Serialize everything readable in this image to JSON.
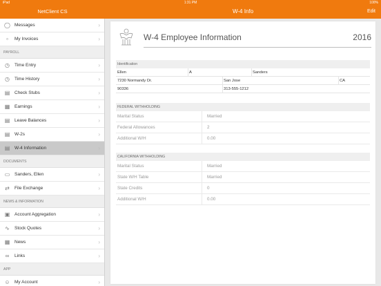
{
  "status_bar": {
    "carrier": "iPad",
    "time": "1:31 PM",
    "battery": "100%"
  },
  "left_nav": {
    "title": "NetClient CS"
  },
  "right_nav": {
    "title": "W-4 Info",
    "edit_label": "Edit"
  },
  "sidebar": {
    "top_items": [
      {
        "label": "Messages",
        "icon": "chat-bubble-icon"
      },
      {
        "label": "My Invoices",
        "icon": "invoice-icon"
      }
    ],
    "payroll_header": "PAYROLL",
    "payroll_items": [
      {
        "label": "Time Entry",
        "icon": "clock-icon"
      },
      {
        "label": "Time History",
        "icon": "clock-history-icon"
      },
      {
        "label": "Check Stubs",
        "icon": "document-icon"
      },
      {
        "label": "Earnings",
        "icon": "earnings-icon"
      },
      {
        "label": "Leave Balances",
        "icon": "document-icon"
      },
      {
        "label": "W-2s",
        "icon": "document-icon"
      },
      {
        "label": "W-4 Information",
        "icon": "w4-form-icon"
      }
    ],
    "documents_header": "DOCUMENTS",
    "documents_items": [
      {
        "label": "Sanders, Ellen",
        "icon": "folder-icon"
      },
      {
        "label": "File Exchange",
        "icon": "file-exchange-icon"
      }
    ],
    "news_header": "NEWS & INFORMATION",
    "news_items": [
      {
        "label": "Account Aggregation",
        "icon": "account-icon"
      },
      {
        "label": "Stock Quotes",
        "icon": "stock-chart-icon"
      },
      {
        "label": "News",
        "icon": "news-icon"
      },
      {
        "label": "Links",
        "icon": "link-icon"
      }
    ],
    "app_header": "APP",
    "app_items": [
      {
        "label": "My Account",
        "icon": "person-icon"
      }
    ]
  },
  "form": {
    "title": "W-4 Employee Information",
    "year": "2016",
    "identification": {
      "header": "Identification",
      "first_name": "Ellen",
      "middle_initial": "A",
      "last_name": "Sanders",
      "address": "7230 Normandy Dr.",
      "city": "San Jose",
      "state": "CA",
      "zip": "90336",
      "phone": "313-555-1212"
    },
    "federal": {
      "header": "FEDERAL WITHHOLDING",
      "rows": [
        {
          "label": "Marital Status",
          "value": "Married"
        },
        {
          "label": "Federal Allowances",
          "value": "2"
        },
        {
          "label": "Additional W/H",
          "value": "0.00"
        }
      ]
    },
    "california": {
      "header": "CALIFORNIA WITHHOLDING",
      "rows": [
        {
          "label": "Marital Status",
          "value": "Married"
        },
        {
          "label": "State W/H Table",
          "value": "Married"
        },
        {
          "label": "State Credits",
          "value": "0"
        },
        {
          "label": "Additional W/H",
          "value": "0.00"
        }
      ]
    }
  },
  "colors": {
    "accent": "#f07a0e",
    "active_item": "#c9c9c9"
  }
}
